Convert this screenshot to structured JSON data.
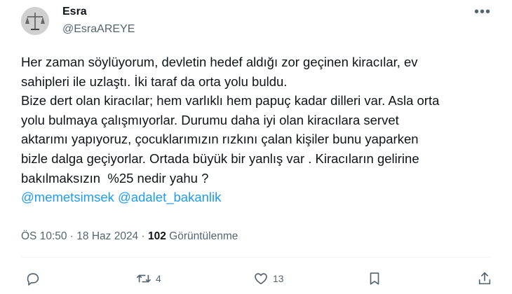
{
  "author": {
    "name": "Esra",
    "handle": "@EsraAREYE"
  },
  "tweet": {
    "text": "Her zaman söylüyorum, devletin hedef aldığı zor geçinen kiracılar, ev\nsahipleri ile uzlaştı. İki taraf da orta yolu buldu.\nBize dert olan kiracılar; hem varlıklı hem papuç kadar dilleri var. Asla orta\nyolu bulmaya çalışmıyorlar. Durumu daha iyi olan kiracılara servet\naktarımı yapıyoruz, çocuklarımızın rızkını çalan kişiler bunu yaparken\nbizle dalga geçiyorlar. Ortada büyük bir yanlış var . Kiracıların gelirine\nbakılmaksızın  %25 nedir yahu ?",
    "mentions": [
      "@memetsimsek",
      "@adalet_bakanlik"
    ]
  },
  "meta": {
    "time": "ÖS 10:50",
    "sep1": " · ",
    "date": "18 Haz 2024",
    "sep2": " · ",
    "views": "102",
    "views_label": " Görüntülenme"
  },
  "actions": {
    "retweets": "4",
    "likes": "13"
  },
  "icons": [
    "more-icon",
    "reply-icon",
    "retweet-icon",
    "like-icon",
    "bookmark-icon",
    "share-icon"
  ]
}
